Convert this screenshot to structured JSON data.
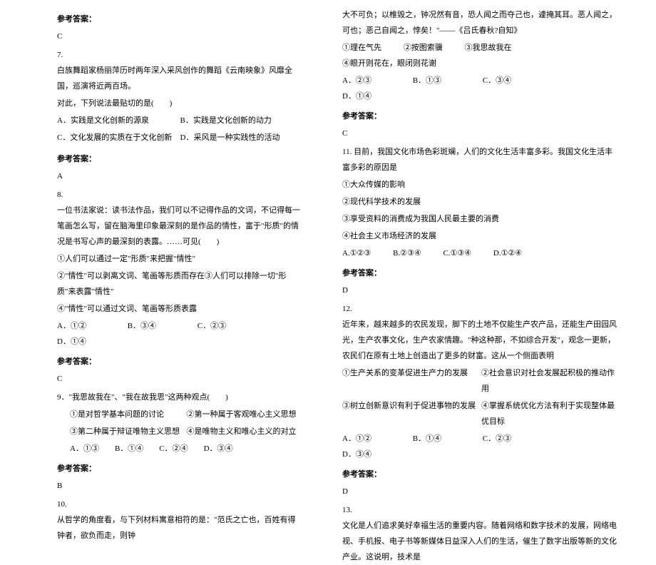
{
  "left": {
    "ref_label": "参考答案：",
    "ans6": "C",
    "q7num": "7.",
    "q7p1": "白族舞蹈家杨丽萍历时两年深入采风创作的舞蹈《云南映象》风靡全国，巡演将近两百场。",
    "q7p2": "对此，下列说法最贴切的是(　　)",
    "q7a": "A．实践是文化创新的源泉",
    "q7b": "B．实践是文化创新的动力",
    "q7c": "C．文化发展的实质在于文化创新",
    "q7d": "D．采风是一种实践性的活动",
    "ans7": "A",
    "q8num": "8.",
    "q8p1": "一位书法家说：读书法作品，我们可以不记得作品的文词，不记得每一笔画怎么写，留在脑海里印象最深刻的是作品的情性，富于\"形质\"的情况是书写心声的最深刻的表露。……可见(　　)",
    "q8s1": "①人们可以通过一定\"形质\"来把握\"情性\"",
    "q8s2": "②\"情性\"可以剥离文词、笔画等形质而存在③人们可以排除一切\"形质\"来表露\"情性\"",
    "q8s3": "④\"情性\"可以通过文词、笔画等形质表露",
    "q8a": "A．①②",
    "q8b": "B．③④",
    "q8c": "C．②③",
    "q8d": "D．①④",
    "ans8": "C",
    "q9p1": "9．\"我思故我在\"、\"我在故我思\"这两种观点(　　)",
    "q9s1": "①是对哲学基本问题的讨论",
    "q9s2": "②第一种属于客观唯心主义思想",
    "q9s3": "③第二种属于辩证唯物主义思想",
    "q9s4": "④是唯物主义和唯心主义的对立",
    "q9opts": "A．①③　　B．①④　　C．②④　　D．③④",
    "ans9": "B",
    "q10num": "10.",
    "q10p1": "从哲学的角度看，与下列材料寓意相符的是：\"范氏之亡也，百姓有得钟者，欲负而走，则钟"
  },
  "right": {
    "ref_label": "参考答案：",
    "q10p2": "大不可负；以椎毁之，钟况然有音，恐人闻之而夺己也，遽掩其耳。恶人闻之，可也；恶己自闻之，悖矣！\"——《吕氏春秋?自知》",
    "q10s1": "①理在气先",
    "q10s2": "②按图索骥",
    "q10s3": "③我思故我在",
    "q10s4": "④眼开则花在，眼闭则花谢",
    "q10a": "A．②③",
    "q10b": "B．①③",
    "q10c": "C．③④",
    "q10d": "D．①④",
    "ans10": "C",
    "q11p1": "11. 目前，我国文化市场色彩斑斓，人们的文化生活丰富多彩。我国文化生活丰富多彩的原因是",
    "q11s1": "①大众传媒的影响",
    "q11s2": "②现代科学技术的发展",
    "q11s3": "③享受资料的消费成为我国人民最主要的消费",
    "q11s4": "④社会主义市场经济的发展",
    "q11a": "A.①②③",
    "q11b": "B.②③④",
    "q11c": "C.①③④",
    "q11d": "D.①②④",
    "ans11": "D",
    "q12num": "12.",
    "q12p1": "近年来，越来越多的农民发现，脚下的土地不仅能生产农产品，还能生产田园风光，生产农事文化，生产农家情趣。\"种这种那，不如综合开发\"，观念一更新，农民们在原有土地上创造出了更多的财富。这从一个侧面表明",
    "q12s1": "①生产关系的变革促进生产力的发展",
    "q12s2": "②社会意识对社会发展起积极的推动作用",
    "q12s3": "③树立创新意识有利于促进事物的发展",
    "q12s4": "④掌握系统优化方法有利于实现整体最优目标",
    "q12a": "A．①②",
    "q12b": "B．①④",
    "q12c": "C．②③",
    "q12d": "D．③④",
    "ans12": "D",
    "q13num": "13.",
    "q13p1": "文化是人们追求美好幸福生活的重要内容。随着网络和数字技术的发展，网络电视、手机报、电子书等新媒体日益深入人们的生活，催生了数字出版等新的文化产业。这说明，技术是"
  }
}
